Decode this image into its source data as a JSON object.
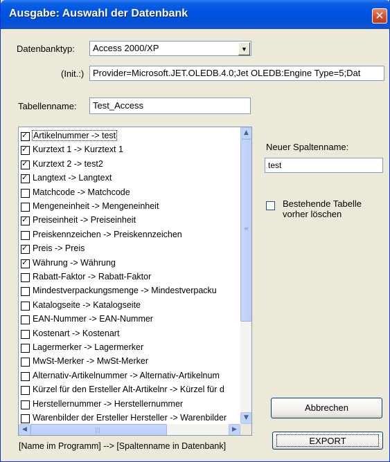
{
  "window": {
    "title": "Ausgabe: Auswahl der Datenbank",
    "close_glyph": "✕"
  },
  "form": {
    "db_type_label": "Datenbanktyp:",
    "db_type_value": "Access 2000/XP",
    "init_label": "(Init.:)",
    "init_value": "Provider=Microsoft.JET.OLEDB.4.0;Jet OLEDB:Engine Type=5;Dat",
    "table_name_label": "Tabellenname:",
    "table_name_value": "Test_Access",
    "new_column_label": "Neuer Spaltenname:",
    "new_column_value": "test",
    "delete_existing_label_line1": "Bestehende Tabelle",
    "delete_existing_label_line2": "vorher löschen",
    "delete_existing_checked": false,
    "footer_hint": "[Name im Programm] --> [Spaltenname in Datenbank]"
  },
  "buttons": {
    "cancel": "Abbrechen",
    "export": "EXPORT"
  },
  "columns": [
    {
      "text": "Artikelnummer -> test",
      "checked": true
    },
    {
      "text": "Kurztext 1 -> Kurztext 1",
      "checked": true
    },
    {
      "text": "Kurztext 2 -> test2",
      "checked": true
    },
    {
      "text": "Langtext -> Langtext",
      "checked": true
    },
    {
      "text": "Matchcode -> Matchcode",
      "checked": false
    },
    {
      "text": "Mengeneinheit -> Mengeneinheit",
      "checked": false
    },
    {
      "text": "Preiseinheit -> Preiseinheit",
      "checked": true
    },
    {
      "text": "Preiskennzeichen -> Preiskennzeichen",
      "checked": false
    },
    {
      "text": "Preis -> Preis",
      "checked": true
    },
    {
      "text": "Währung -> Währung",
      "checked": true
    },
    {
      "text": "Rabatt-Faktor -> Rabatt-Faktor",
      "checked": false
    },
    {
      "text": "Mindestverpackungsmenge -> Mindestverpacku",
      "checked": false
    },
    {
      "text": "Katalogseite -> Katalogseite",
      "checked": false
    },
    {
      "text": "EAN-Nummer -> EAN-Nummer",
      "checked": false
    },
    {
      "text": "Kostenart -> Kostenart",
      "checked": false
    },
    {
      "text": "Lagermerker -> Lagermerker",
      "checked": false
    },
    {
      "text": "MwSt-Merker -> MwSt-Merker",
      "checked": false
    },
    {
      "text": "Alternativ-Artikelnummer -> Alternativ-Artikelnum",
      "checked": false
    },
    {
      "text": "Kürzel für den Ersteller Alt-Artikelnr -> Kürzel für d",
      "checked": false
    },
    {
      "text": "Herstellernummer -> Herstellernummer",
      "checked": false
    },
    {
      "text": "Warenbilder der Ersteller Hersteller -> Warenbilder",
      "checked": false
    }
  ],
  "selected_index": 0
}
